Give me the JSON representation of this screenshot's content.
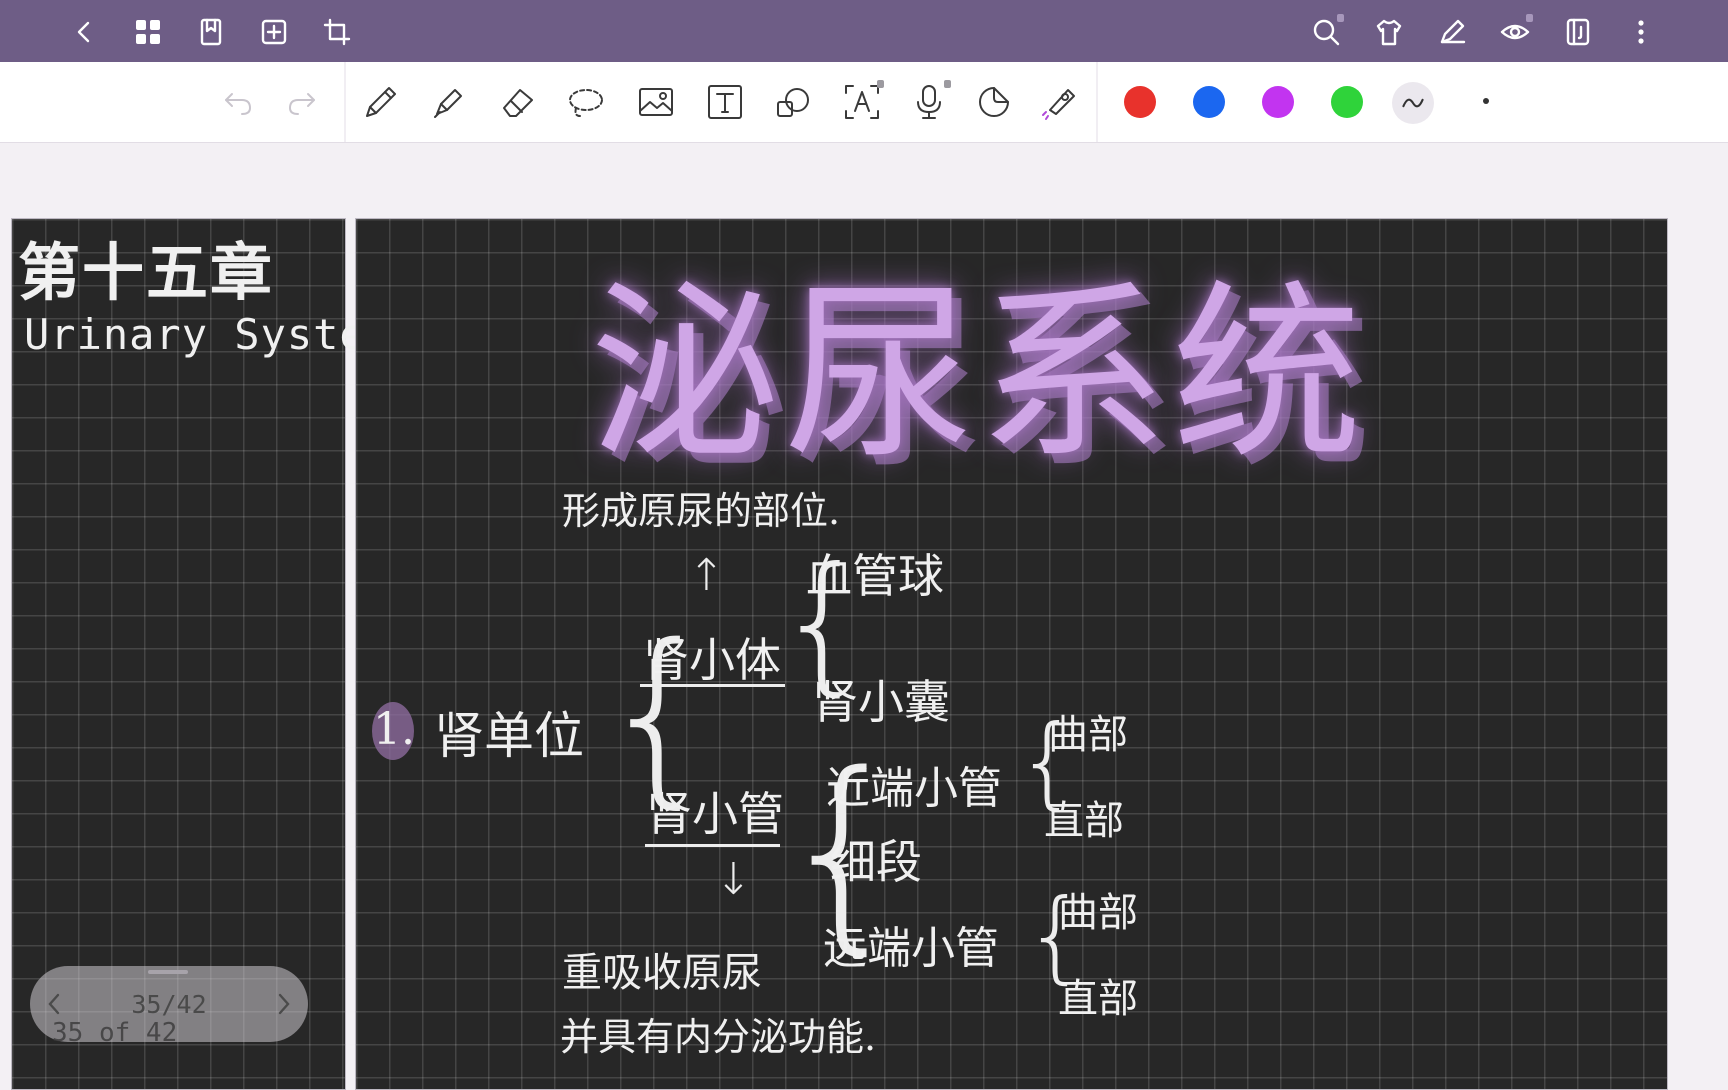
{
  "topbar": {
    "icons": [
      "back-icon",
      "grid-icon",
      "bookmark-icon",
      "add-page-icon",
      "crop-icon",
      "search-icon",
      "shirt-icon",
      "pen-edit-icon",
      "eye-icon",
      "page-layout-icon",
      "more-icon"
    ]
  },
  "toolbar": {
    "tools": [
      "undo-icon",
      "redo-icon",
      "pen-icon",
      "highlighter-icon",
      "eraser-icon",
      "lasso-icon",
      "image-icon",
      "text-icon",
      "shape-icon",
      "ocr-icon",
      "microphone-icon",
      "sticker-icon",
      "laser-pointer-icon"
    ],
    "colors": [
      "#e8322c",
      "#1b67f0",
      "#c234f0",
      "#2fd33a"
    ]
  },
  "left_page": {
    "chapter": "第十五章",
    "subtitle": "Urinary System."
  },
  "main_page": {
    "title": "泌尿系统",
    "top_note": "形成原尿的部位.",
    "numbering": "1.",
    "root": "肾单位",
    "branch1": "肾小体",
    "branch1_children": [
      "血管球",
      "肾小囊"
    ],
    "branch2": "肾小管",
    "proximal": "近端小管",
    "proximal_children": [
      "曲部",
      "直部"
    ],
    "thin_segment": "细段",
    "distal": "远端小管",
    "distal_children": [
      "曲部",
      "直部"
    ],
    "bottom_note_1": "重吸收原尿",
    "bottom_note_2": "并具有内分泌功能."
  },
  "pager": {
    "count": "35/42",
    "of_label": "35 of 42"
  }
}
